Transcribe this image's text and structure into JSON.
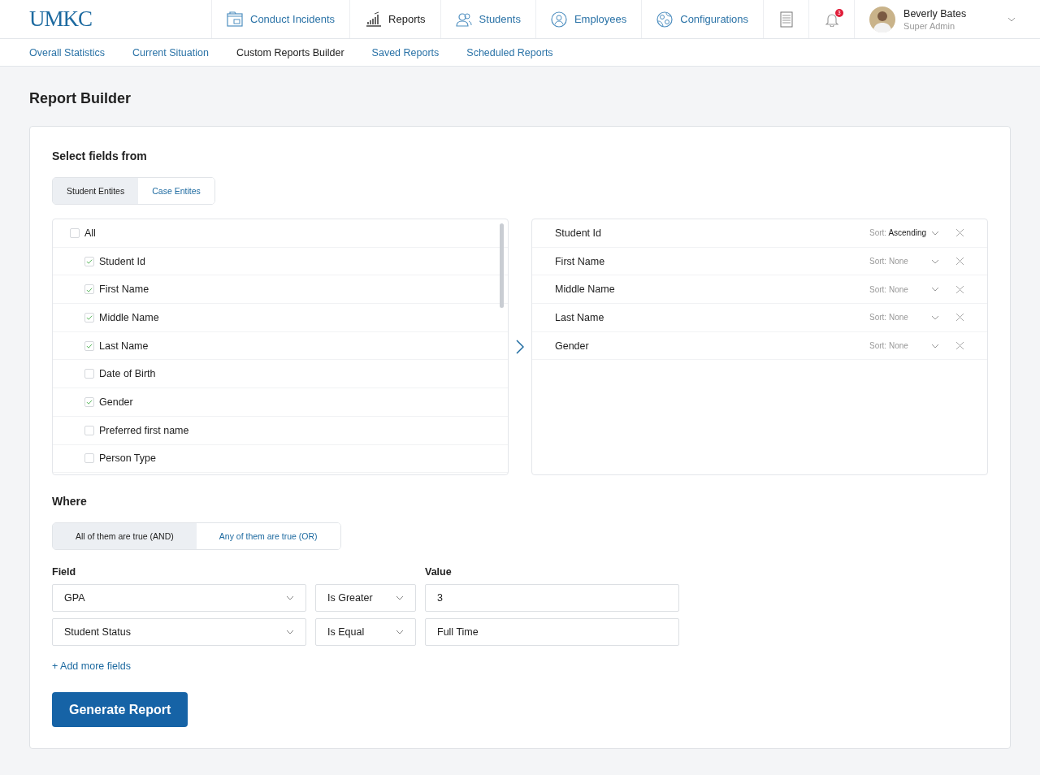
{
  "logo": "UMKC",
  "nav": [
    {
      "label": "Conduct Incidents",
      "kind": "folder",
      "selected": false
    },
    {
      "label": "Reports",
      "kind": "chart",
      "selected": true
    },
    {
      "label": "Students",
      "kind": "people",
      "selected": false
    },
    {
      "label": "Employees",
      "kind": "person",
      "selected": false
    },
    {
      "label": "Configurations",
      "kind": "globe",
      "selected": false
    }
  ],
  "notifications": {
    "badge": "3"
  },
  "user": {
    "name": "Beverly Bates",
    "role": "Super Admin"
  },
  "subnav": [
    {
      "label": "Overall Statistics",
      "selected": false
    },
    {
      "label": "Current Situation",
      "selected": false
    },
    {
      "label": "Custom Reports Builder",
      "selected": true
    },
    {
      "label": "Saved Reports",
      "selected": false
    },
    {
      "label": "Scheduled Reports",
      "selected": false
    }
  ],
  "page_title": "Report Builder",
  "select_title": "Select fields from",
  "source_tabs": [
    {
      "label": "Student Entites",
      "selected": true
    },
    {
      "label": "Case Entites",
      "selected": false
    }
  ],
  "field_list": {
    "all": {
      "label": "All",
      "checked": false
    },
    "items": [
      {
        "label": "Student Id",
        "checked": true
      },
      {
        "label": "First Name",
        "checked": true
      },
      {
        "label": "Middle Name",
        "checked": true
      },
      {
        "label": "Last Name",
        "checked": true
      },
      {
        "label": "Date of Birth",
        "checked": false
      },
      {
        "label": "Gender",
        "checked": true
      },
      {
        "label": "Preferred first name",
        "checked": false
      },
      {
        "label": "Person Type",
        "checked": false
      }
    ]
  },
  "selected_fields": [
    {
      "name": "Student Id",
      "sort_label": "Sort:",
      "sort": "Ascending",
      "sort_set": true
    },
    {
      "name": "First Name",
      "sort_label": "Sort:",
      "sort": "None",
      "sort_set": false
    },
    {
      "name": "Middle Name",
      "sort_label": "Sort:",
      "sort": "None",
      "sort_set": false
    },
    {
      "name": "Last Name",
      "sort_label": "Sort:",
      "sort": "None",
      "sort_set": false
    },
    {
      "name": "Gender",
      "sort_label": "Sort:",
      "sort": "None",
      "sort_set": false
    }
  ],
  "where_title": "Where",
  "logic_tabs": [
    {
      "label": "All of them are true (AND)",
      "selected": true
    },
    {
      "label": "Any of them are true (OR)",
      "selected": false
    }
  ],
  "field_label": "Field",
  "value_label": "Value",
  "conditions": [
    {
      "field": "GPA",
      "operator": "Is Greater",
      "value": "3"
    },
    {
      "field": "Student Status",
      "operator": "Is Equal",
      "value": "Full Time"
    }
  ],
  "add_link": "+ Add more fields",
  "generate_button": "Generate Report"
}
